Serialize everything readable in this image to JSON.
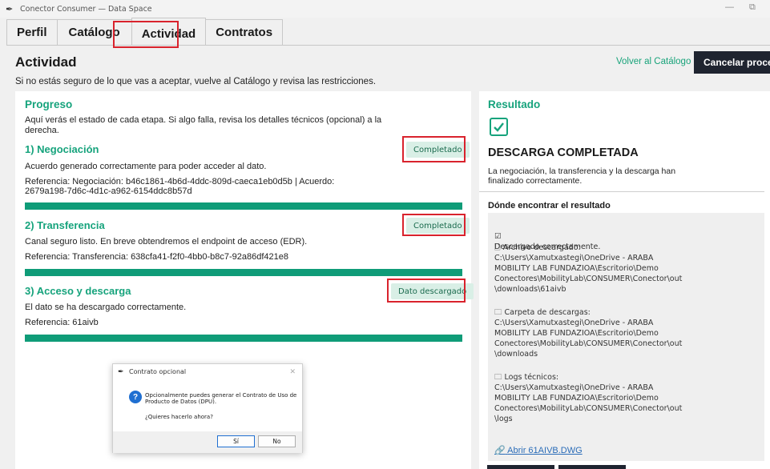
{
  "window": {
    "title": "Conector Consumer — Data Space"
  },
  "tabs": [
    {
      "label": "Perfil"
    },
    {
      "label": "Catálogo"
    },
    {
      "label": "Actividad"
    },
    {
      "label": "Contratos"
    }
  ],
  "header": {
    "title": "Actividad",
    "subtitle": "Si no estás seguro de lo que vas a aceptar, vuelve al Catálogo y revisa las restricciones.",
    "back_link": "Volver al Catálogo",
    "cancel_button": "Cancelar proceso"
  },
  "progress": {
    "title": "Progreso",
    "intro_line1": "Aquí verás el estado de cada etapa. Si algo falla, revisa los detalles técnicos (opcional) a la",
    "intro_line2": "derecha.",
    "steps": [
      {
        "title": "1) Negociación",
        "badge": "Completado",
        "desc": "Acuerdo generado correctamente para poder acceder al dato.",
        "ref_line1": "Referencia: Negociación: b46c1861-4b6d-4ddc-809d-caeca1eb0d5b | Acuerdo:",
        "ref_line2": "2679a198-7d6c-4d1c-a962-6154ddc8b57d",
        "progress": 1.0
      },
      {
        "title": "2) Transferencia",
        "badge": "Completado",
        "desc": "Canal seguro listo. En breve obtendremos el endpoint de acceso (EDR).",
        "ref_line1": "Referencia: Transferencia: 638cfa41-f2f0-4bb0-b8c7-92a86df421e8",
        "progress": 1.0
      },
      {
        "title": "3) Acceso y descarga",
        "badge": "Dato descargado",
        "desc": "El dato se ha descargado correctamente.",
        "ref_line1": "Referencia: 61aivb",
        "progress": 1.0
      }
    ]
  },
  "result": {
    "title": "Resultado",
    "headline": "DESCARGA COMPLETADA",
    "summary_line1": "La negociación, la transferencia y la descarga han",
    "summary_line2": "finalizado correctamente.",
    "where_title": "Dónde encontrar el resultado",
    "status_item": "Descargado correctamente.",
    "file_item": "Archivo descargado:\n  C:\\Users\\Xamutxastegi\\OneDrive - ARABA\nMOBILITY LAB FUNDAZIOA\\Escritorio\\Demo\nConectores\\MobilityLab\\CONSUMER\\Conector\\out\n\\downloads\\61aivb",
    "folder_item": "Carpeta de descargas:\n  C:\\Users\\Xamutxastegi\\OneDrive - ARABA\nMOBILITY LAB FUNDAZIOA\\Escritorio\\Demo\nConectores\\MobilityLab\\CONSUMER\\Conector\\out\n\\downloads",
    "logs_item": "Logs técnicos:\n  C:\\Users\\Xamutxastegi\\OneDrive - ARABA\nMOBILITY LAB FUNDAZIOA\\Escritorio\\Demo\nConectores\\MobilityLab\\CONSUMER\\Conector\\out\n\\logs",
    "open_link": "Abrir 61AIVB.DWG"
  },
  "dialog": {
    "title": "Contrato opcional",
    "message": "Opcionalmente puedes generar el Contrato de Uso de Producto de Datos (DPU).",
    "question": "¿Quieres hacerlo ahora?",
    "yes": "Sí",
    "no": "No"
  },
  "colors": {
    "accent": "#16a37c",
    "highlight": "#d9232d",
    "dark_button": "#1f2430",
    "badge_bg": "#d9efe6"
  },
  "icons": [
    "feather-icon",
    "check-square-icon",
    "checkbox-icon",
    "file-icon",
    "folder-icon",
    "link-icon",
    "question-icon",
    "close-icon",
    "minimize-icon",
    "restore-icon"
  ]
}
